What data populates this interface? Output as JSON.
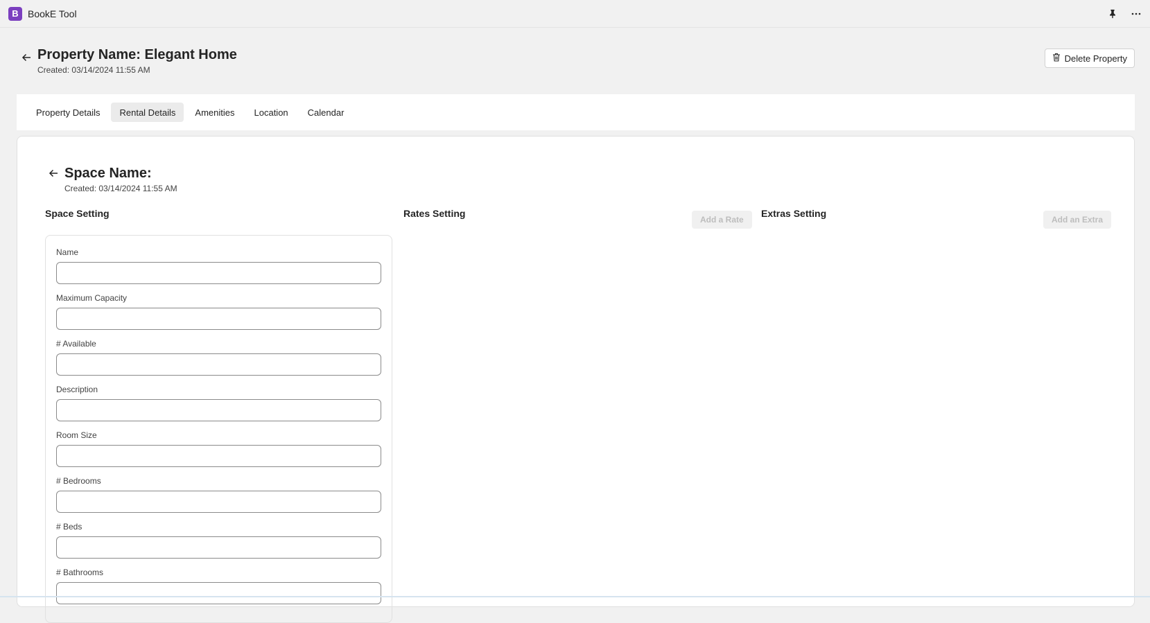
{
  "app": {
    "title": "BookE Tool",
    "logo_letter": "B"
  },
  "header": {
    "title": "Property Name: Elegant Home",
    "created": "Created: 03/14/2024 11:55 AM",
    "delete_label": "Delete Property"
  },
  "tabs": [
    {
      "label": "Property Details",
      "active": false
    },
    {
      "label": "Rental Details",
      "active": true
    },
    {
      "label": "Amenities",
      "active": false
    },
    {
      "label": "Location",
      "active": false
    },
    {
      "label": "Calendar",
      "active": false
    }
  ],
  "space": {
    "title": "Space Name:",
    "created": "Created: 03/14/2024 11:55 AM"
  },
  "columns": {
    "space_setting": "Space Setting",
    "rates_setting": "Rates Setting",
    "add_rate": "Add a Rate",
    "extras_setting": "Extras Setting",
    "add_extra": "Add an Extra"
  },
  "fields": [
    {
      "label": "Name",
      "value": ""
    },
    {
      "label": "Maximum Capacity",
      "value": ""
    },
    {
      "label": "# Available",
      "value": ""
    },
    {
      "label": "Description",
      "value": ""
    },
    {
      "label": "Room Size",
      "value": ""
    },
    {
      "label": "# Bedrooms",
      "value": ""
    },
    {
      "label": "# Beds",
      "value": ""
    },
    {
      "label": "# Bathrooms",
      "value": ""
    }
  ],
  "colors": {
    "brand": "#7b3fbf",
    "background": "#f1f1f1",
    "active_tab": "#ebebeb"
  },
  "icons": [
    "pin-icon",
    "more-icon",
    "back-arrow-icon",
    "trash-icon"
  ]
}
